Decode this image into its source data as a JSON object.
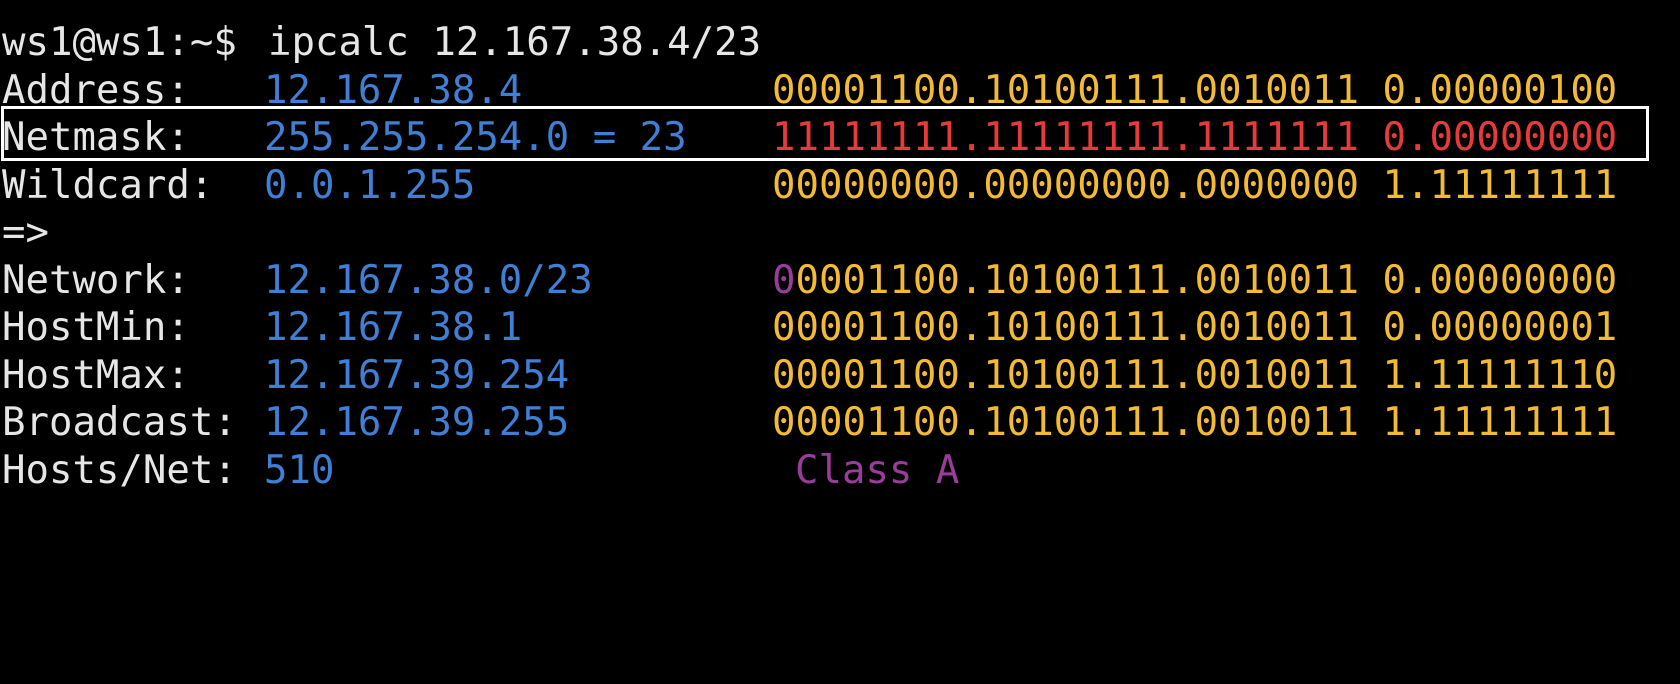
{
  "colors": {
    "background": "#000000",
    "text": "#e6e6e6",
    "value": "#3f7fd4",
    "binary": "#f3bb33",
    "netmask_binary": "#e83a3a",
    "class": "#9a3c9a",
    "network_prefix": "#9a3c9a",
    "highlight_border": "#ffffff"
  },
  "prompt": {
    "user_host": "ws1@ws1:~$",
    "command": "ipcalc 12.167.38.4/23"
  },
  "rows": [
    {
      "label": "Address:",
      "value": "12.167.38.4",
      "binary": "00001100.10100111.0010011 0.00000100"
    },
    {
      "label": "Netmask:",
      "value": "255.255.254.0 = 23",
      "binary": "11111111.11111111.1111111 0.00000000"
    },
    {
      "label": "Wildcard:",
      "value": "0.0.1.255",
      "binary": "00000000.00000000.0000000 1.11111111"
    },
    {
      "label": "=>"
    },
    {
      "label": "Network:",
      "value": "12.167.38.0/23",
      "binary_prefix": "0",
      "binary_rest": "0001100.10100111.0010011 0.00000000"
    },
    {
      "label": "HostMin:",
      "value": "12.167.38.1",
      "binary": "00001100.10100111.0010011 0.00000001"
    },
    {
      "label": "HostMax:",
      "value": "12.167.39.254",
      "binary": "00001100.10100111.0010011 1.11111110"
    },
    {
      "label": "Broadcast:",
      "value": "12.167.39.255",
      "binary": "00001100.10100111.0010011 1.11111111"
    },
    {
      "label": "Hosts/Net:",
      "value": "510",
      "class": "Class A"
    }
  ]
}
